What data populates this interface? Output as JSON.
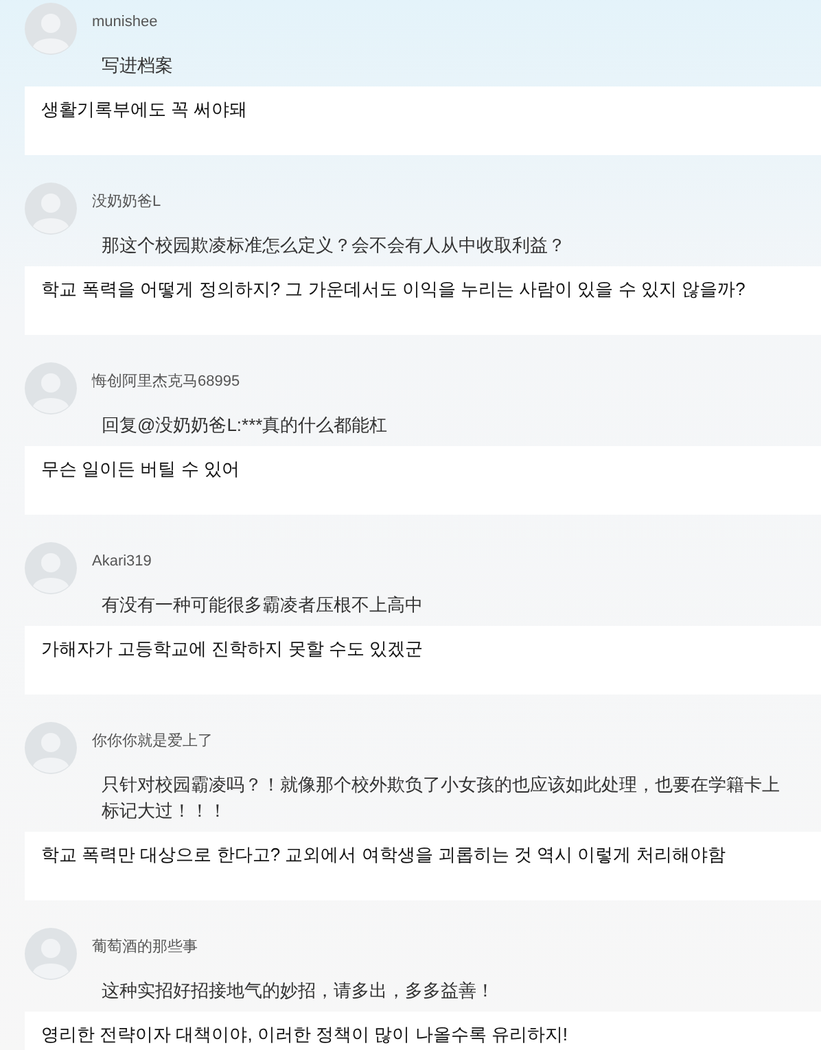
{
  "comments": [
    {
      "username": "munishee",
      "text": "写进档案",
      "translation": "생활기록부에도 꼭 써야돼"
    },
    {
      "username": "没奶奶爸L",
      "text": "那这个校园欺凌标准怎么定义？会不会有人从中收取利益？",
      "translation": "학교 폭력을 어떻게 정의하지? 그 가운데서도 이익을 누리는 사람이 있을 수 있지 않을까?"
    },
    {
      "username": "悔创阿里杰克马68995",
      "text": "回复@没奶奶爸L:***真的什么都能杠",
      "translation": "무슨 일이든 버틸 수 있어"
    },
    {
      "username": "Akari319",
      "text": "有没有一种可能很多霸凌者压根不上高中",
      "translation": "가해자가 고등학교에 진학하지 못할 수도 있겠군"
    },
    {
      "username": "你你你就是爱上了",
      "text": "只针对校园霸凌吗？！就像那个校外欺负了小女孩的也应该如此处理，也要在学籍卡上标记大过！！！",
      "translation": "학교 폭력만 대상으로 한다고? 교외에서 여학생을 괴롭히는 것 역시 이렇게 처리해야함"
    },
    {
      "username": "葡萄酒的那些事",
      "text": "这种实招好招接地气的妙招，请多出，多多益善！",
      "translation": "영리한 전략이자 대책이야, 이러한 정책이 많이 나올수록 유리하지!"
    }
  ]
}
